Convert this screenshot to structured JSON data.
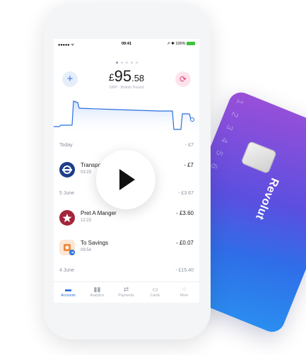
{
  "card": {
    "brand": "Revolut",
    "digits": "1 2 3 4   5 6"
  },
  "status_bar": {
    "signal": "●●●●● ᯤ",
    "time": "09:41",
    "indicators": "➚ ✱ 100%"
  },
  "account": {
    "currency_symbol": "£",
    "balance_int": "95",
    "balance_dec": ".58",
    "currency_name": "GBP · British Pound"
  },
  "sections": [
    {
      "label": "Today",
      "total": "- £7"
    },
    {
      "label": "5 June",
      "total": "- £3.67"
    },
    {
      "label": "4 June",
      "total": "- £15.40"
    }
  ],
  "transactions": [
    {
      "name": "Transport",
      "time": "03:23",
      "amount": "- £7"
    },
    {
      "name": "Pret A Manger",
      "time": "12:23",
      "amount": "- £3.60"
    },
    {
      "name": "To Savings",
      "time": "09:54",
      "amount": "- £0.07"
    }
  ],
  "tabs": [
    {
      "label": "Accounts",
      "icon": "wallet-icon"
    },
    {
      "label": "Analytics",
      "icon": "bar-chart-icon"
    },
    {
      "label": "Payments",
      "icon": "transfer-icon"
    },
    {
      "label": "Cards",
      "icon": "card-icon"
    },
    {
      "label": "More",
      "icon": "more-icon"
    }
  ],
  "colors": {
    "accent": "#2b6fe0",
    "exchange": "#e53d6c",
    "transport": "#1d3e8a",
    "pret": "#a3253b",
    "savings": "#f08a3c"
  }
}
